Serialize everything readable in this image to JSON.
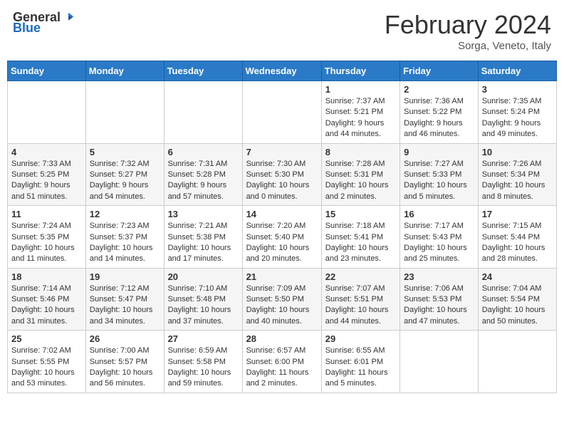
{
  "header": {
    "logo_general": "General",
    "logo_blue": "Blue",
    "title": "February 2024",
    "subtitle": "Sorga, Veneto, Italy"
  },
  "days_of_week": [
    "Sunday",
    "Monday",
    "Tuesday",
    "Wednesday",
    "Thursday",
    "Friday",
    "Saturday"
  ],
  "weeks": [
    [
      {
        "day": "",
        "detail": ""
      },
      {
        "day": "",
        "detail": ""
      },
      {
        "day": "",
        "detail": ""
      },
      {
        "day": "",
        "detail": ""
      },
      {
        "day": "1",
        "detail": "Sunrise: 7:37 AM\nSunset: 5:21 PM\nDaylight: 9 hours\nand 44 minutes."
      },
      {
        "day": "2",
        "detail": "Sunrise: 7:36 AM\nSunset: 5:22 PM\nDaylight: 9 hours\nand 46 minutes."
      },
      {
        "day": "3",
        "detail": "Sunrise: 7:35 AM\nSunset: 5:24 PM\nDaylight: 9 hours\nand 49 minutes."
      }
    ],
    [
      {
        "day": "4",
        "detail": "Sunrise: 7:33 AM\nSunset: 5:25 PM\nDaylight: 9 hours\nand 51 minutes."
      },
      {
        "day": "5",
        "detail": "Sunrise: 7:32 AM\nSunset: 5:27 PM\nDaylight: 9 hours\nand 54 minutes."
      },
      {
        "day": "6",
        "detail": "Sunrise: 7:31 AM\nSunset: 5:28 PM\nDaylight: 9 hours\nand 57 minutes."
      },
      {
        "day": "7",
        "detail": "Sunrise: 7:30 AM\nSunset: 5:30 PM\nDaylight: 10 hours\nand 0 minutes."
      },
      {
        "day": "8",
        "detail": "Sunrise: 7:28 AM\nSunset: 5:31 PM\nDaylight: 10 hours\nand 2 minutes."
      },
      {
        "day": "9",
        "detail": "Sunrise: 7:27 AM\nSunset: 5:33 PM\nDaylight: 10 hours\nand 5 minutes."
      },
      {
        "day": "10",
        "detail": "Sunrise: 7:26 AM\nSunset: 5:34 PM\nDaylight: 10 hours\nand 8 minutes."
      }
    ],
    [
      {
        "day": "11",
        "detail": "Sunrise: 7:24 AM\nSunset: 5:35 PM\nDaylight: 10 hours\nand 11 minutes."
      },
      {
        "day": "12",
        "detail": "Sunrise: 7:23 AM\nSunset: 5:37 PM\nDaylight: 10 hours\nand 14 minutes."
      },
      {
        "day": "13",
        "detail": "Sunrise: 7:21 AM\nSunset: 5:38 PM\nDaylight: 10 hours\nand 17 minutes."
      },
      {
        "day": "14",
        "detail": "Sunrise: 7:20 AM\nSunset: 5:40 PM\nDaylight: 10 hours\nand 20 minutes."
      },
      {
        "day": "15",
        "detail": "Sunrise: 7:18 AM\nSunset: 5:41 PM\nDaylight: 10 hours\nand 23 minutes."
      },
      {
        "day": "16",
        "detail": "Sunrise: 7:17 AM\nSunset: 5:43 PM\nDaylight: 10 hours\nand 25 minutes."
      },
      {
        "day": "17",
        "detail": "Sunrise: 7:15 AM\nSunset: 5:44 PM\nDaylight: 10 hours\nand 28 minutes."
      }
    ],
    [
      {
        "day": "18",
        "detail": "Sunrise: 7:14 AM\nSunset: 5:46 PM\nDaylight: 10 hours\nand 31 minutes."
      },
      {
        "day": "19",
        "detail": "Sunrise: 7:12 AM\nSunset: 5:47 PM\nDaylight: 10 hours\nand 34 minutes."
      },
      {
        "day": "20",
        "detail": "Sunrise: 7:10 AM\nSunset: 5:48 PM\nDaylight: 10 hours\nand 37 minutes."
      },
      {
        "day": "21",
        "detail": "Sunrise: 7:09 AM\nSunset: 5:50 PM\nDaylight: 10 hours\nand 40 minutes."
      },
      {
        "day": "22",
        "detail": "Sunrise: 7:07 AM\nSunset: 5:51 PM\nDaylight: 10 hours\nand 44 minutes."
      },
      {
        "day": "23",
        "detail": "Sunrise: 7:06 AM\nSunset: 5:53 PM\nDaylight: 10 hours\nand 47 minutes."
      },
      {
        "day": "24",
        "detail": "Sunrise: 7:04 AM\nSunset: 5:54 PM\nDaylight: 10 hours\nand 50 minutes."
      }
    ],
    [
      {
        "day": "25",
        "detail": "Sunrise: 7:02 AM\nSunset: 5:55 PM\nDaylight: 10 hours\nand 53 minutes."
      },
      {
        "day": "26",
        "detail": "Sunrise: 7:00 AM\nSunset: 5:57 PM\nDaylight: 10 hours\nand 56 minutes."
      },
      {
        "day": "27",
        "detail": "Sunrise: 6:59 AM\nSunset: 5:58 PM\nDaylight: 10 hours\nand 59 minutes."
      },
      {
        "day": "28",
        "detail": "Sunrise: 6:57 AM\nSunset: 6:00 PM\nDaylight: 11 hours\nand 2 minutes."
      },
      {
        "day": "29",
        "detail": "Sunrise: 6:55 AM\nSunset: 6:01 PM\nDaylight: 11 hours\nand 5 minutes."
      },
      {
        "day": "",
        "detail": ""
      },
      {
        "day": "",
        "detail": ""
      }
    ]
  ]
}
